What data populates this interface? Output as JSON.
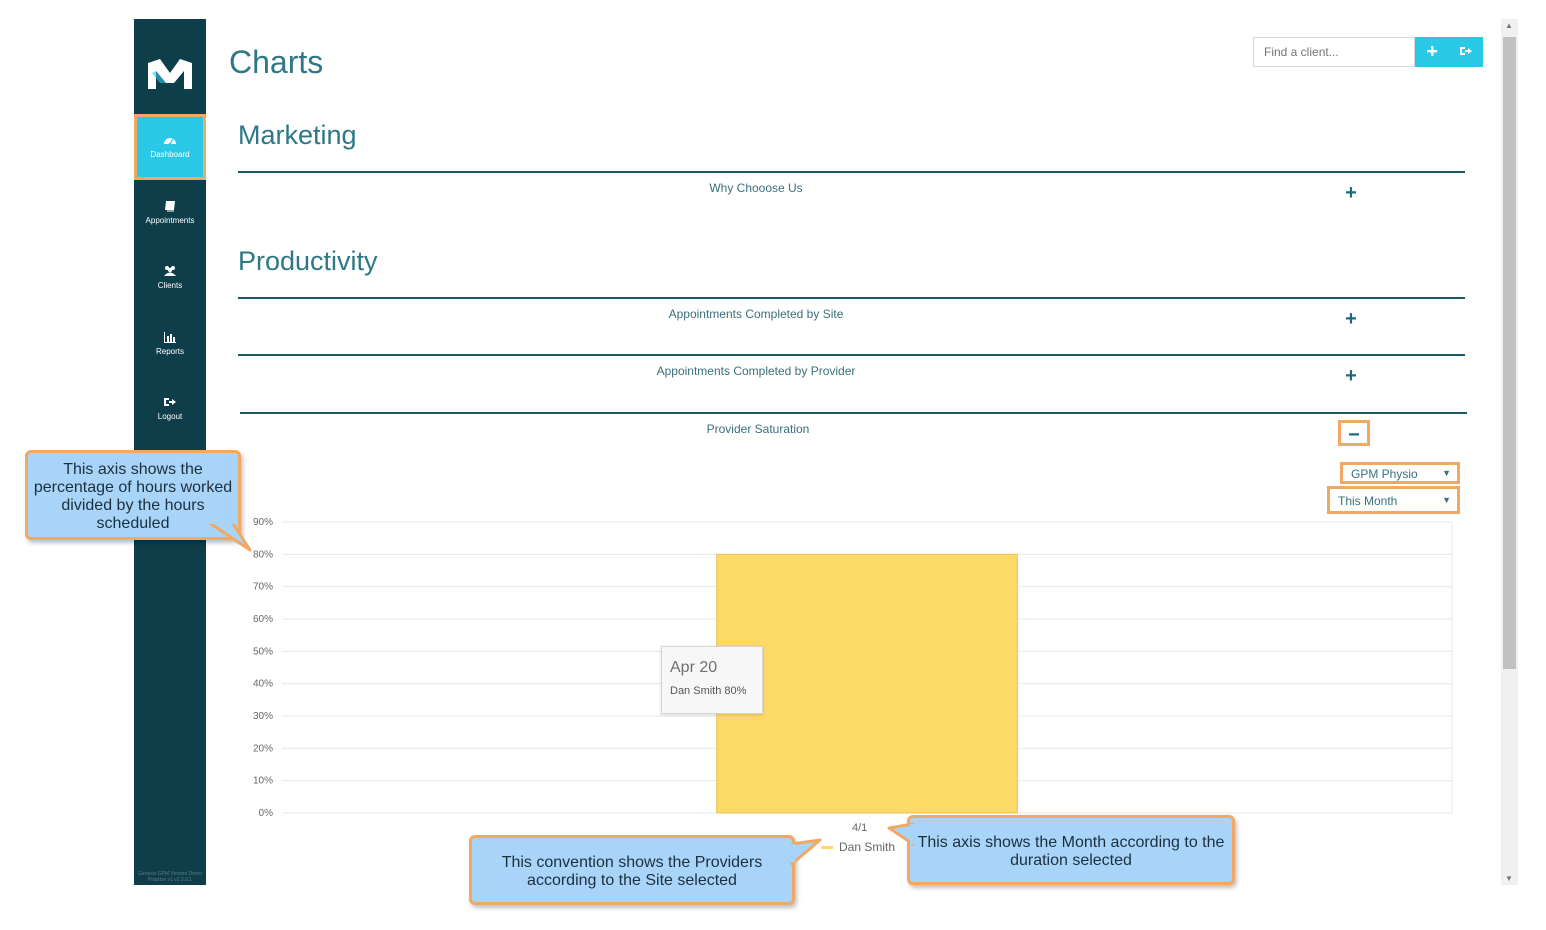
{
  "app": {
    "brand_color": "#0e3e4a",
    "accent_color": "#29c8e6",
    "highlight_color": "#f0a862"
  },
  "sidebar": {
    "logo": "m-logo-icon",
    "items": [
      {
        "label": "Dashboard",
        "icon": "dashboard-gauge-icon",
        "active": true
      },
      {
        "label": "Appointments",
        "icon": "book-icon",
        "active": false
      },
      {
        "label": "Clients",
        "icon": "users-icon",
        "active": false
      },
      {
        "label": "Reports",
        "icon": "bar-chart-icon",
        "active": false
      },
      {
        "label": "Logout",
        "icon": "sign-out-icon",
        "active": false
      }
    ],
    "footer": "Genesis GPM Version Demo Practice v1 v1.2.0.1"
  },
  "header": {
    "title": "Charts",
    "search_placeholder": "Find a client...",
    "add_button_icon": "plus-icon",
    "logout_button_icon": "sign-out-icon"
  },
  "sections": {
    "marketing": {
      "title": "Marketing",
      "items": [
        {
          "label": "Why Chooose Us",
          "toggle": "+"
        }
      ]
    },
    "productivity": {
      "title": "Productivity",
      "items": [
        {
          "label": "Appointments Completed by Site",
          "toggle": "+"
        },
        {
          "label": "Appointments Completed by Provider",
          "toggle": "+"
        },
        {
          "label": "Provider Saturation",
          "toggle": "−"
        }
      ]
    }
  },
  "filters": {
    "site": "GPM Physio",
    "period": "This Month"
  },
  "chart_data": {
    "type": "bar",
    "categories": [
      "4/1"
    ],
    "series": [
      {
        "name": "Dan Smith",
        "values": [
          80
        ],
        "color": "#fdd967"
      }
    ],
    "y_ticks": [
      "0%",
      "10%",
      "20%",
      "30%",
      "40%",
      "50%",
      "60%",
      "70%",
      "80%",
      "90%"
    ],
    "ylim": [
      0,
      90
    ],
    "grid": true,
    "legend_position": "bottom",
    "tooltip": {
      "title": "Apr 20",
      "text": "Dan Smith 80%"
    }
  },
  "callouts": {
    "y_axis": "This axis shows the percentage of hours worked divided by the hours scheduled",
    "legend": "This convention shows the Providers according to the Site selected",
    "x_axis": "This axis shows the Month according to the duration selected"
  }
}
